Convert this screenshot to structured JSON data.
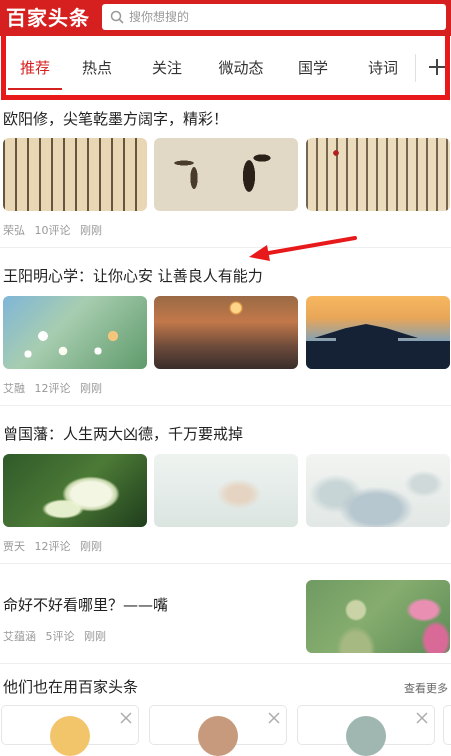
{
  "header": {
    "logo": "百家头条",
    "search_placeholder": "搜你想搜的"
  },
  "tabs": [
    {
      "label": "推荐",
      "active": true
    },
    {
      "label": "热点"
    },
    {
      "label": "关注"
    },
    {
      "label": "微动态"
    },
    {
      "label": "国学"
    },
    {
      "label": "诗词"
    }
  ],
  "articles": [
    {
      "title": "欧阳修，尖笔乾墨方阔字，精彩！",
      "author": "荣弘",
      "comments": "10评论",
      "time": "刚刚"
    },
    {
      "title": "王阳明心学：让你心安 让善良人有能力",
      "author": "艾融",
      "comments": "12评论",
      "time": "刚刚"
    },
    {
      "title": "曾国藩：人生两大凶德，千万要戒掉",
      "author": "贾天",
      "comments": "12评论",
      "time": "刚刚"
    },
    {
      "title": "命好不好看哪里？——嘴",
      "author": "艾蕴涵",
      "comments": "5评论",
      "time": "刚刚"
    }
  ],
  "also_using": {
    "title": "他们也在用百家头条",
    "see_more": "查看更多"
  },
  "colors": {
    "brand_red": "#d6201f",
    "annotation_red": "#e8191b"
  }
}
